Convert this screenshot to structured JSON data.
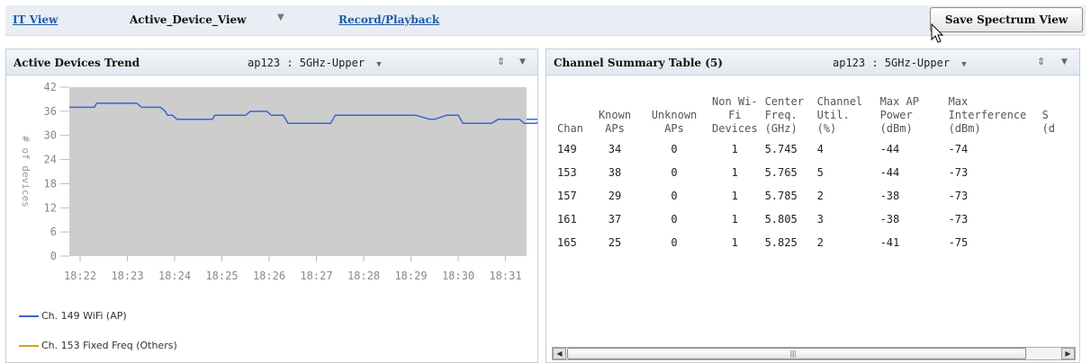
{
  "topbar": {
    "it_view": "IT View",
    "active_view": "Active_Device_View",
    "record_playback": "Record/Playback",
    "save_button": "Save Spectrum View"
  },
  "trend_panel": {
    "title": "Active Devices Trend",
    "selector": "ap123 : 5GHz-Upper",
    "legend": [
      {
        "label": "Ch. 149 WiFi (AP)",
        "color": "#3a64d8"
      },
      {
        "label": "Ch. 153 Fixed Freq (Others)",
        "color": "#d8a21a"
      }
    ]
  },
  "chart_data": {
    "type": "line",
    "title": "",
    "xlabel": "",
    "ylabel": "# of devices",
    "ylim": [
      0,
      42
    ],
    "yticks": [
      0,
      6,
      12,
      18,
      24,
      30,
      36,
      42
    ],
    "xticks": [
      "18:22",
      "18:23",
      "18:24",
      "18:25",
      "18:26",
      "18:27",
      "18:28",
      "18:29",
      "18:30",
      "18:31"
    ],
    "plot_background": "#cdcdcd",
    "series": [
      {
        "name": "Ch. 149 WiFi (AP)",
        "color": "#3a64d8",
        "x": [
          0,
          0.3,
          0.35,
          1.2,
          1.3,
          1.7,
          1.8,
          1.85,
          1.95,
          2.05,
          2.8,
          2.85,
          3.5,
          3.6,
          3.95,
          4.05,
          4.3,
          4.4,
          4.55,
          4.65,
          5.3,
          5.4,
          6.2,
          6.3,
          6.6,
          6.7,
          7.0,
          7.1,
          7.4,
          7.5,
          7.75,
          7.85,
          8.0,
          8.1,
          8.6,
          8.7,
          8.85,
          8.95,
          9.3,
          9.4,
          9.65,
          9.75
        ],
        "values": [
          37,
          37,
          38,
          38,
          37,
          37,
          36,
          35,
          35,
          34,
          34,
          35,
          35,
          36,
          36,
          35,
          35,
          33,
          33,
          33,
          33,
          35,
          35,
          35,
          35,
          35,
          35,
          35,
          34,
          34,
          35,
          35,
          35,
          33,
          33,
          33,
          34,
          34,
          34,
          33,
          33,
          34
        ]
      }
    ]
  },
  "channel_panel": {
    "title": "Channel Summary Table (5)",
    "selector": "ap123 : 5GHz-Upper",
    "columns": [
      {
        "label": "Chan",
        "align": "l"
      },
      {
        "label": "Known APs",
        "align": "c"
      },
      {
        "label": "Unknown APs",
        "align": "c"
      },
      {
        "label": "Non Wi-Fi Devices",
        "align": "c"
      },
      {
        "label": "Center Freq. (GHz)",
        "align": "l"
      },
      {
        "label": "Channel Util. (%)",
        "align": "l"
      },
      {
        "label": "Max AP Power (dBm)",
        "align": "l"
      },
      {
        "label": "Max Interference (dBm)",
        "align": "l"
      },
      {
        "label": "S (d",
        "align": "l"
      }
    ],
    "rows": [
      [
        "149",
        "34",
        "0",
        "1",
        "5.745",
        "4",
        "-44",
        "-74",
        ""
      ],
      [
        "153",
        "38",
        "0",
        "1",
        "5.765",
        "5",
        "-44",
        "-73",
        ""
      ],
      [
        "157",
        "29",
        "0",
        "1",
        "5.785",
        "2",
        "-38",
        "-73",
        ""
      ],
      [
        "161",
        "37",
        "0",
        "1",
        "5.805",
        "3",
        "-38",
        "-73",
        ""
      ],
      [
        "165",
        "25",
        "0",
        "1",
        "5.825",
        "2",
        "-41",
        "-75",
        ""
      ]
    ]
  }
}
